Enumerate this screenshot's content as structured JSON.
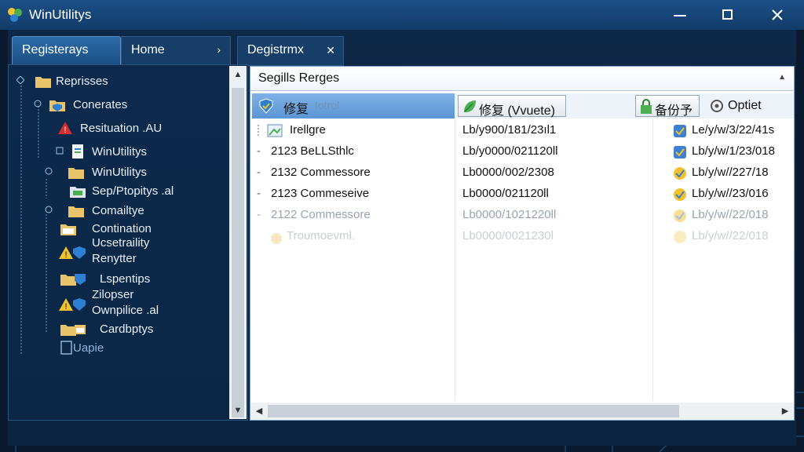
{
  "window": {
    "title": "WinUtilitys"
  },
  "tabs": {
    "left": "Registerays",
    "home": "Home",
    "right": "Degistrmx"
  },
  "tree": {
    "items": [
      {
        "label": "Reprisses"
      },
      {
        "label": "Conerates"
      },
      {
        "label": "Resituation .AU"
      },
      {
        "label": "WinUtilitys"
      },
      {
        "label": "WinUtilitys"
      },
      {
        "label": "Sep/Ptopitys .al"
      },
      {
        "label": "Comailtye"
      },
      {
        "label": "Contination"
      },
      {
        "label": "Ucsetraility"
      },
      {
        "label": "Renytter"
      },
      {
        "label": "Lspentips"
      },
      {
        "label": "Zilopser"
      },
      {
        "label": "Ownpilice .al"
      },
      {
        "label": "Cardbptys"
      },
      {
        "label": "Uapie"
      }
    ]
  },
  "right": {
    "header": "Segills Rerges",
    "toolbar": {
      "fix": "修复",
      "fix_faded": "Iotrol",
      "fix_update": "修复 (Vvuete)",
      "backup": "备份予",
      "option": "Optiet"
    },
    "rows": [
      {
        "name": "Irellgre",
        "value": "Lb/y900/181/23ıl1",
        "date": "Le/y/w/3/22/41s"
      },
      {
        "name": "2123 BeLLSthlc",
        "value": "Lb/y0000/021120ll",
        "date": "Lb/y/w/1/23/018"
      },
      {
        "name": "2132 Commessore",
        "value": "Lb0000/002/2308",
        "date": "Lb/y/w//227/18"
      },
      {
        "name": "2123 Commeseive",
        "value": "Lb0000/021120ll",
        "date": "Lb/y/w//23/016"
      },
      {
        "name": "2122 Commessore",
        "value": "Lb0000/1021220ll",
        "date": "Lb/y/w//22/018"
      },
      {
        "name": "Troumoevml.",
        "value": "Lb0000/0021230l",
        "date": "Lb/y/w//22/018"
      }
    ]
  }
}
